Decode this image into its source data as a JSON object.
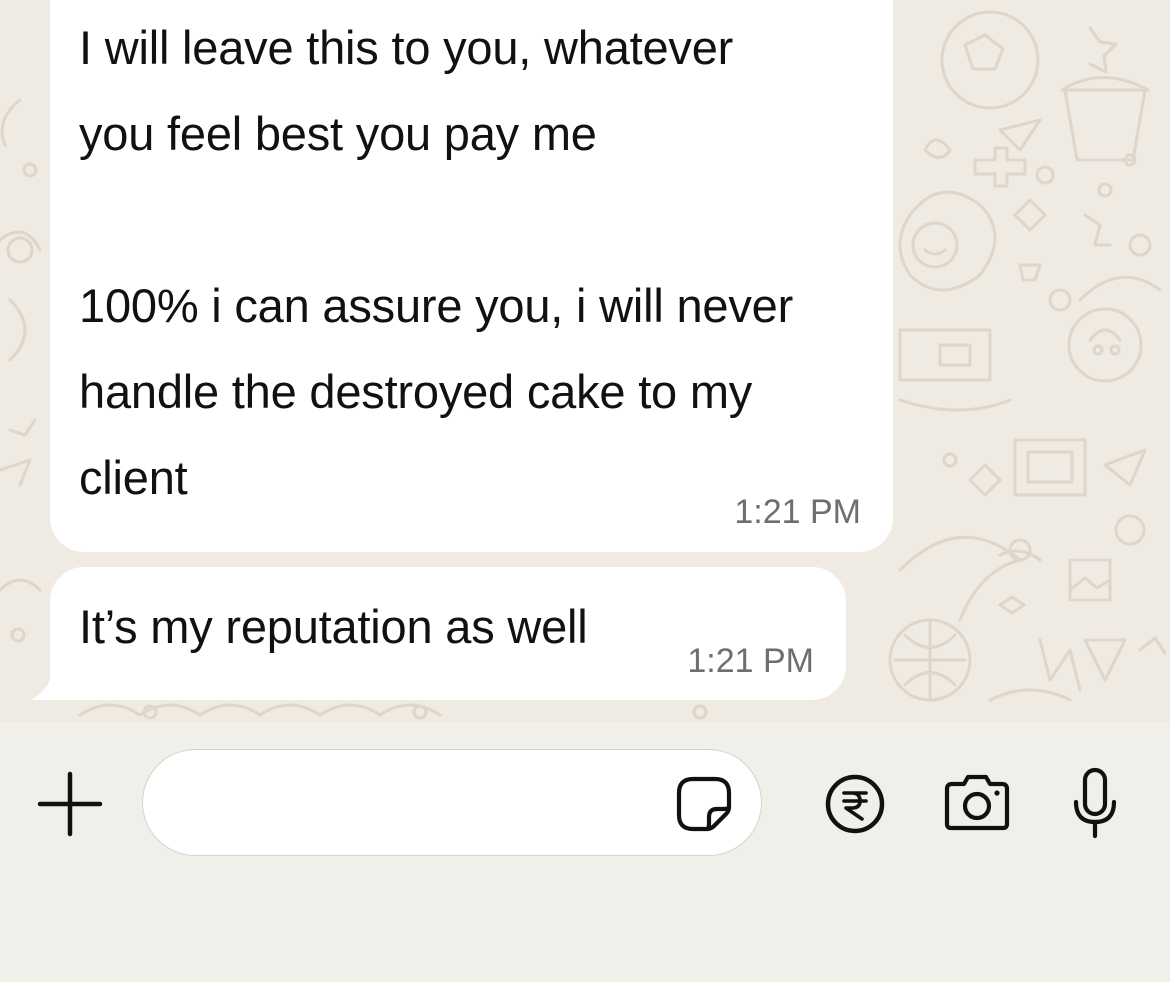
{
  "messages": [
    {
      "lines": [
        "I will leave this to you, whatever",
        "you feel best you pay me",
        "",
        "100% i can assure you, i will never",
        "handle the destroyed cake to my",
        "client"
      ],
      "time": "1:21 PM"
    },
    {
      "lines": [
        "It’s my reputation as well"
      ],
      "time": "1:21 PM"
    }
  ],
  "composer": {
    "value": "",
    "placeholder": "",
    "icons": {
      "attach": "plus-icon",
      "sticker": "sticker-icon",
      "payment": "rupee-icon",
      "camera": "camera-icon",
      "voice": "microphone-icon"
    }
  },
  "colors": {
    "chat_background": "#efeae2",
    "composer_background": "#f1efea",
    "bubble": "#ffffff",
    "text": "#111111",
    "timestamp": "#6e6e6e"
  }
}
